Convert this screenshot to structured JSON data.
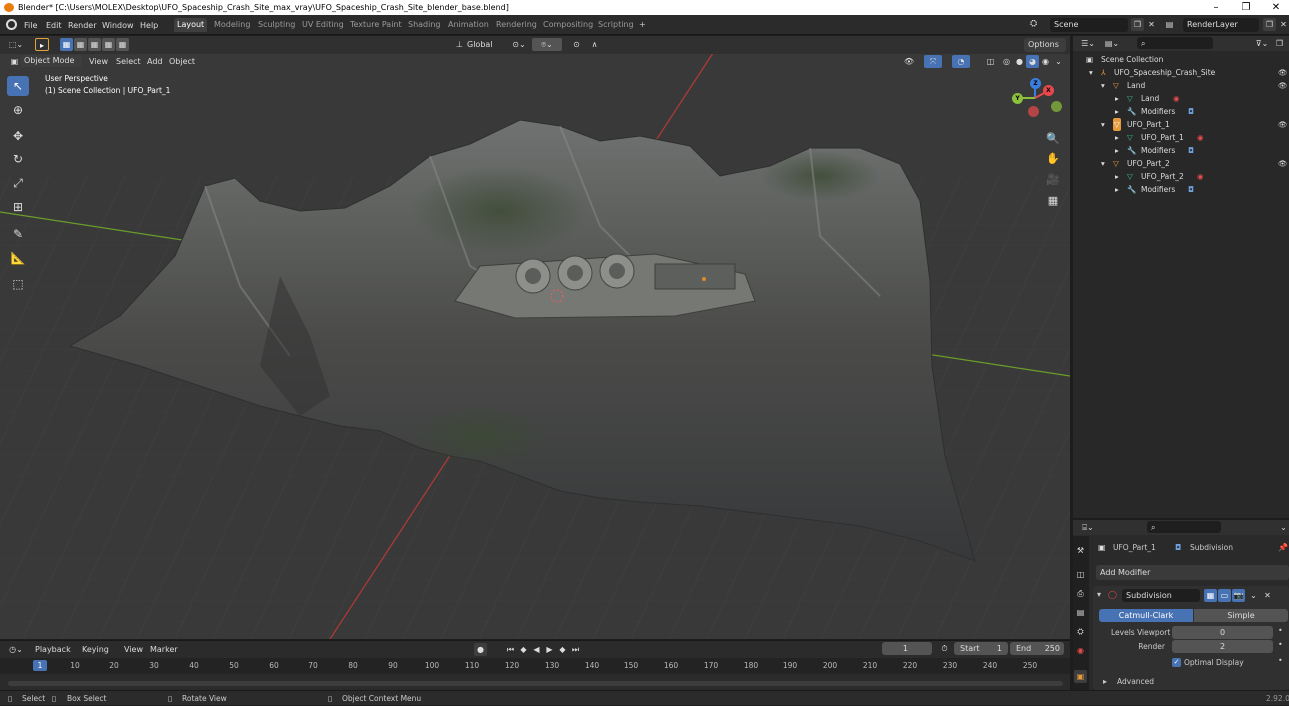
{
  "window": {
    "title": "Blender* [C:\\Users\\MOLEX\\Desktop\\UFO_Spaceship_Crash_Site_max_vray\\UFO_Spaceship_Crash_Site_blender_base.blend]",
    "minimize": "–",
    "restore": "❐",
    "close": "✕"
  },
  "menu": {
    "items": [
      "File",
      "Edit",
      "Render",
      "Window",
      "Help"
    ],
    "workspaces": [
      "Layout",
      "Modeling",
      "Sculpting",
      "UV Editing",
      "Texture Paint",
      "Shading",
      "Animation",
      "Rendering",
      "Compositing",
      "Scripting"
    ],
    "add_workspace": "+",
    "scene_label": "Scene",
    "view_layer": "RenderLayer"
  },
  "viewport": {
    "mode": "Object Mode",
    "menus": [
      "View",
      "Select",
      "Add",
      "Object"
    ],
    "transform_orientation": "Global",
    "options_label": "Options",
    "overlay_line1": "User Perspective",
    "overlay_line2": "(1) Scene Collection | UFO_Part_1",
    "gizmo": {
      "x": "X",
      "y": "Y",
      "z": "Z"
    }
  },
  "outliner": {
    "search_placeholder": "",
    "rows": [
      {
        "label": "Scene Collection"
      },
      {
        "label": "UFO_Spaceship_Crash_Site"
      },
      {
        "label": "Land"
      },
      {
        "label": "Land"
      },
      {
        "label": "Modifiers"
      },
      {
        "label": "UFO_Part_1"
      },
      {
        "label": "UFO_Part_1"
      },
      {
        "label": "Modifiers"
      },
      {
        "label": "UFO_Part_2"
      },
      {
        "label": "UFO_Part_2"
      },
      {
        "label": "Modifiers"
      }
    ]
  },
  "properties": {
    "object_name": "UFO_Part_1",
    "modifier_breadcrumb": "Subdivision",
    "add_modifier": "Add Modifier",
    "modifier_name": "Subdivision",
    "type_catmull": "Catmull-Clark",
    "type_simple": "Simple",
    "levels_viewport_label": "Levels Viewport",
    "levels_viewport_value": "0",
    "render_label": "Render",
    "render_value": "2",
    "optimal_display": "Optimal Display",
    "advanced": "Advanced"
  },
  "timeline": {
    "menus": [
      "Playback",
      "Keying",
      "View",
      "Marker"
    ],
    "current_frame": "1",
    "start_label": "Start",
    "start_value": "1",
    "end_label": "End",
    "end_value": "250",
    "ticks": [
      "1",
      "10",
      "20",
      "30",
      "40",
      "50",
      "60",
      "70",
      "80",
      "90",
      "100",
      "110",
      "120",
      "130",
      "140",
      "150",
      "160",
      "170",
      "180",
      "190",
      "200",
      "210",
      "220",
      "230",
      "240",
      "250"
    ]
  },
  "status": {
    "select": "Select",
    "box_select": "Box Select",
    "rotate_view": "Rotate View",
    "context_menu": "Object Context Menu",
    "version": "2.92.0"
  },
  "colors": {
    "accent": "#4772b3",
    "x_axis": "#b33a3a",
    "y_axis": "#6a9e2a",
    "gizmo_x": "#e8484c",
    "gizmo_y": "#8cc13a",
    "gizmo_z": "#3a7de0"
  }
}
